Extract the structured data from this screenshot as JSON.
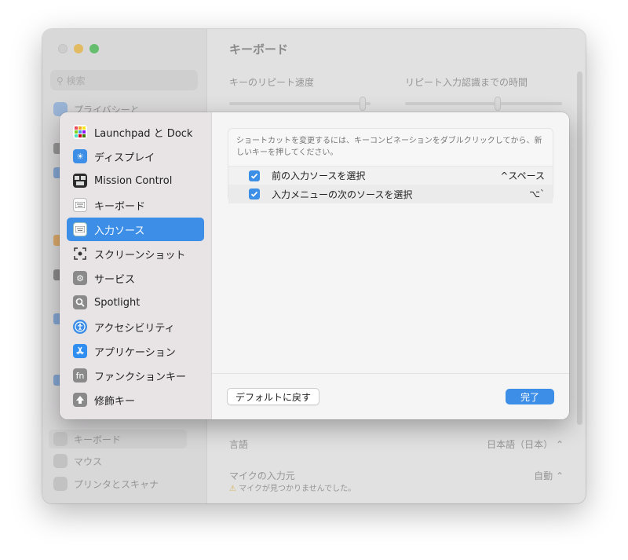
{
  "background": {
    "window_title": "キーボード",
    "search_placeholder": "検索",
    "sidebar_items": [
      {
        "label": "プライバシーと"
      },
      {
        "label": "キーボード"
      },
      {
        "label": "マウス"
      },
      {
        "label": "プリンタとスキャナ"
      }
    ],
    "repeat_speed_label": "キーのリピート速度",
    "repeat_delay_label": "リピート入力認識までの時間",
    "language_label": "言語",
    "language_value": "日本語（日本）",
    "mic_label": "マイクの入力元",
    "mic_value": "自動",
    "mic_warning": "マイクが見つかりませんでした。"
  },
  "sheet": {
    "categories": [
      {
        "label": "Launchpad と Dock",
        "icon": "launchpad-dock-icon"
      },
      {
        "label": "ディスプレイ",
        "icon": "display-icon"
      },
      {
        "label": "Mission Control",
        "icon": "mission-control-icon"
      },
      {
        "label": "キーボード",
        "icon": "keyboard-icon"
      },
      {
        "label": "入力ソース",
        "icon": "input-sources-icon",
        "active": true
      },
      {
        "label": "スクリーンショット",
        "icon": "screenshot-icon"
      },
      {
        "label": "サービス",
        "icon": "services-gear-icon"
      },
      {
        "label": "Spotlight",
        "icon": "spotlight-icon"
      },
      {
        "label": "アクセシビリティ",
        "icon": "accessibility-icon"
      },
      {
        "label": "アプリケーション",
        "icon": "app-store-icon"
      },
      {
        "label": "ファンクションキー",
        "icon": "fn-key-icon"
      },
      {
        "label": "修飾キー",
        "icon": "modifier-key-icon"
      }
    ],
    "description": "ショートカットを変更するには、キーコンビネーションをダブルクリックしてから、新しいキーを押してください。",
    "shortcuts": [
      {
        "name": "前の入力ソースを選択",
        "key": "^スペース",
        "checked": true
      },
      {
        "name": "入力メニューの次のソースを選択",
        "key": "⌥`",
        "checked": true
      }
    ],
    "restore_defaults_label": "デフォルトに戻す",
    "done_label": "完了"
  },
  "colors": {
    "accent": "#3d8ee6",
    "traffic_close": "#d9d9d9",
    "traffic_minimize": "#f6bd3b",
    "traffic_maximize": "#3fc34d"
  }
}
